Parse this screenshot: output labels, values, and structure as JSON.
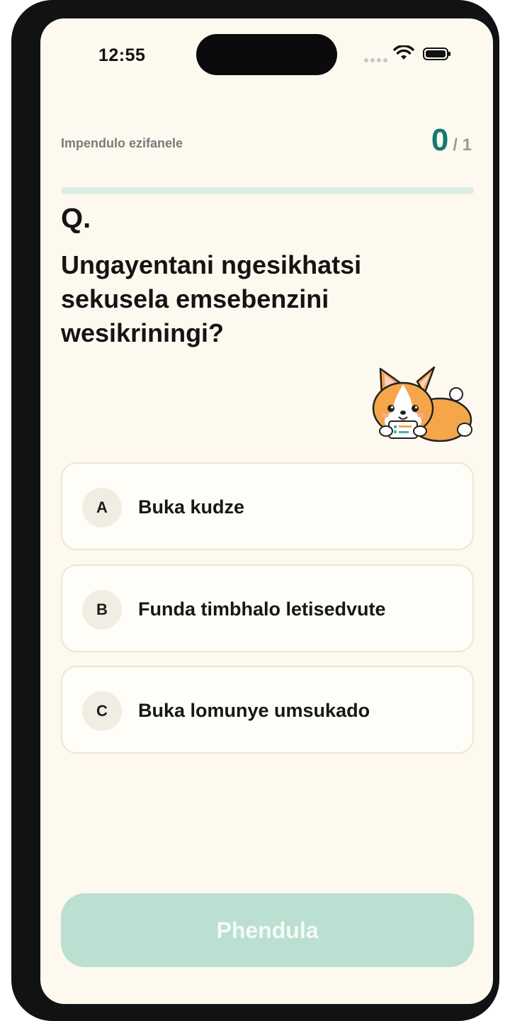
{
  "status_bar": {
    "time": "12:55",
    "icons": [
      "cellular-signal-icon",
      "wifi-icon",
      "battery-icon"
    ]
  },
  "header": {
    "correct_label": "Impendulo ezifanele",
    "score": "0",
    "total": "/ 1",
    "progress": 0
  },
  "question": {
    "prefix": "Q.",
    "text": "Ungayentani ngesikhatsi sekusela emsebenzini wesikriningi?"
  },
  "options": [
    {
      "letter": "A",
      "text": "Buka kudze"
    },
    {
      "letter": "B",
      "text": "Funda timbhalo letisedvute"
    },
    {
      "letter": "C",
      "text": "Buka lomunye umsukado"
    }
  ],
  "submit": {
    "label": "Phendula"
  },
  "colors": {
    "background": "#fdf9ef",
    "accent": "#137a72",
    "button_disabled": "#bbdfd0",
    "option_border": "#efe6cc"
  }
}
